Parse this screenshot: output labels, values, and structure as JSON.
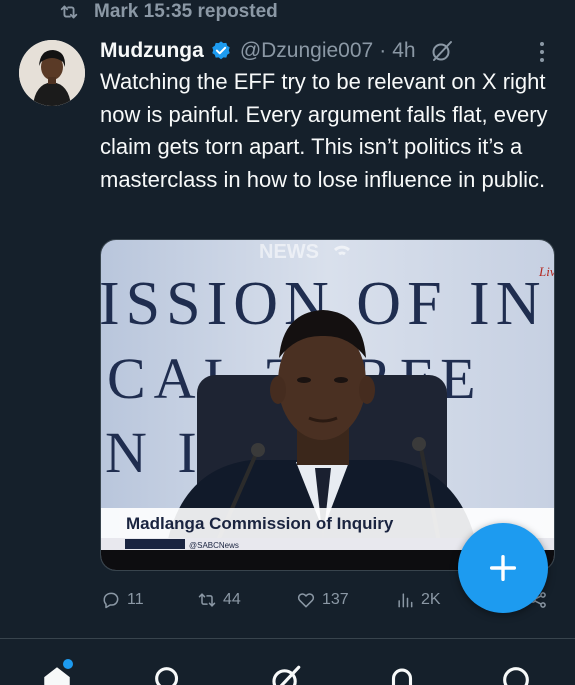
{
  "repost": {
    "label": "Mark 15:35 reposted"
  },
  "tweet": {
    "author_name": "Mudzunga",
    "handle": "@Dzungie007",
    "separator": "·",
    "time": "4h",
    "text": "Watching the EFF try to be relevant on X right now is painful. Every argument falls flat, every claim gets torn apart. This isn’t politics it’s a masterclass in how to lose influence in public.",
    "media": {
      "backdrop_line1": "ISSION OF IN",
      "backdrop_line2": "CAL  TERFE",
      "backdrop_line3": "N     IMI",
      "watermark": "NEWS",
      "live_badge": "Live",
      "lower_third": "Madlanga Commission of Inquiry",
      "social_handle": "@SABCNews"
    }
  },
  "actions": {
    "replies": "11",
    "reposts": "44",
    "likes": "137",
    "views": "2K"
  },
  "colors": {
    "background": "#15202b",
    "accent": "#1d9bf0",
    "muted": "#8b98a5",
    "text": "#f7f9f9",
    "divider": "#38444d"
  },
  "icons": {
    "repost": "repost-icon",
    "verified": "verified-badge-icon",
    "grok": "grok-icon",
    "more": "more-icon",
    "reply": "reply-icon",
    "like": "heart-icon",
    "views": "views-icon",
    "compose": "plus-icon",
    "share": "share-icon",
    "nav_home": "home-icon",
    "nav_search": "search-icon",
    "nav_grok": "grok-icon",
    "nav_notifications": "notifications-icon",
    "nav_messages": "messages-icon"
  }
}
